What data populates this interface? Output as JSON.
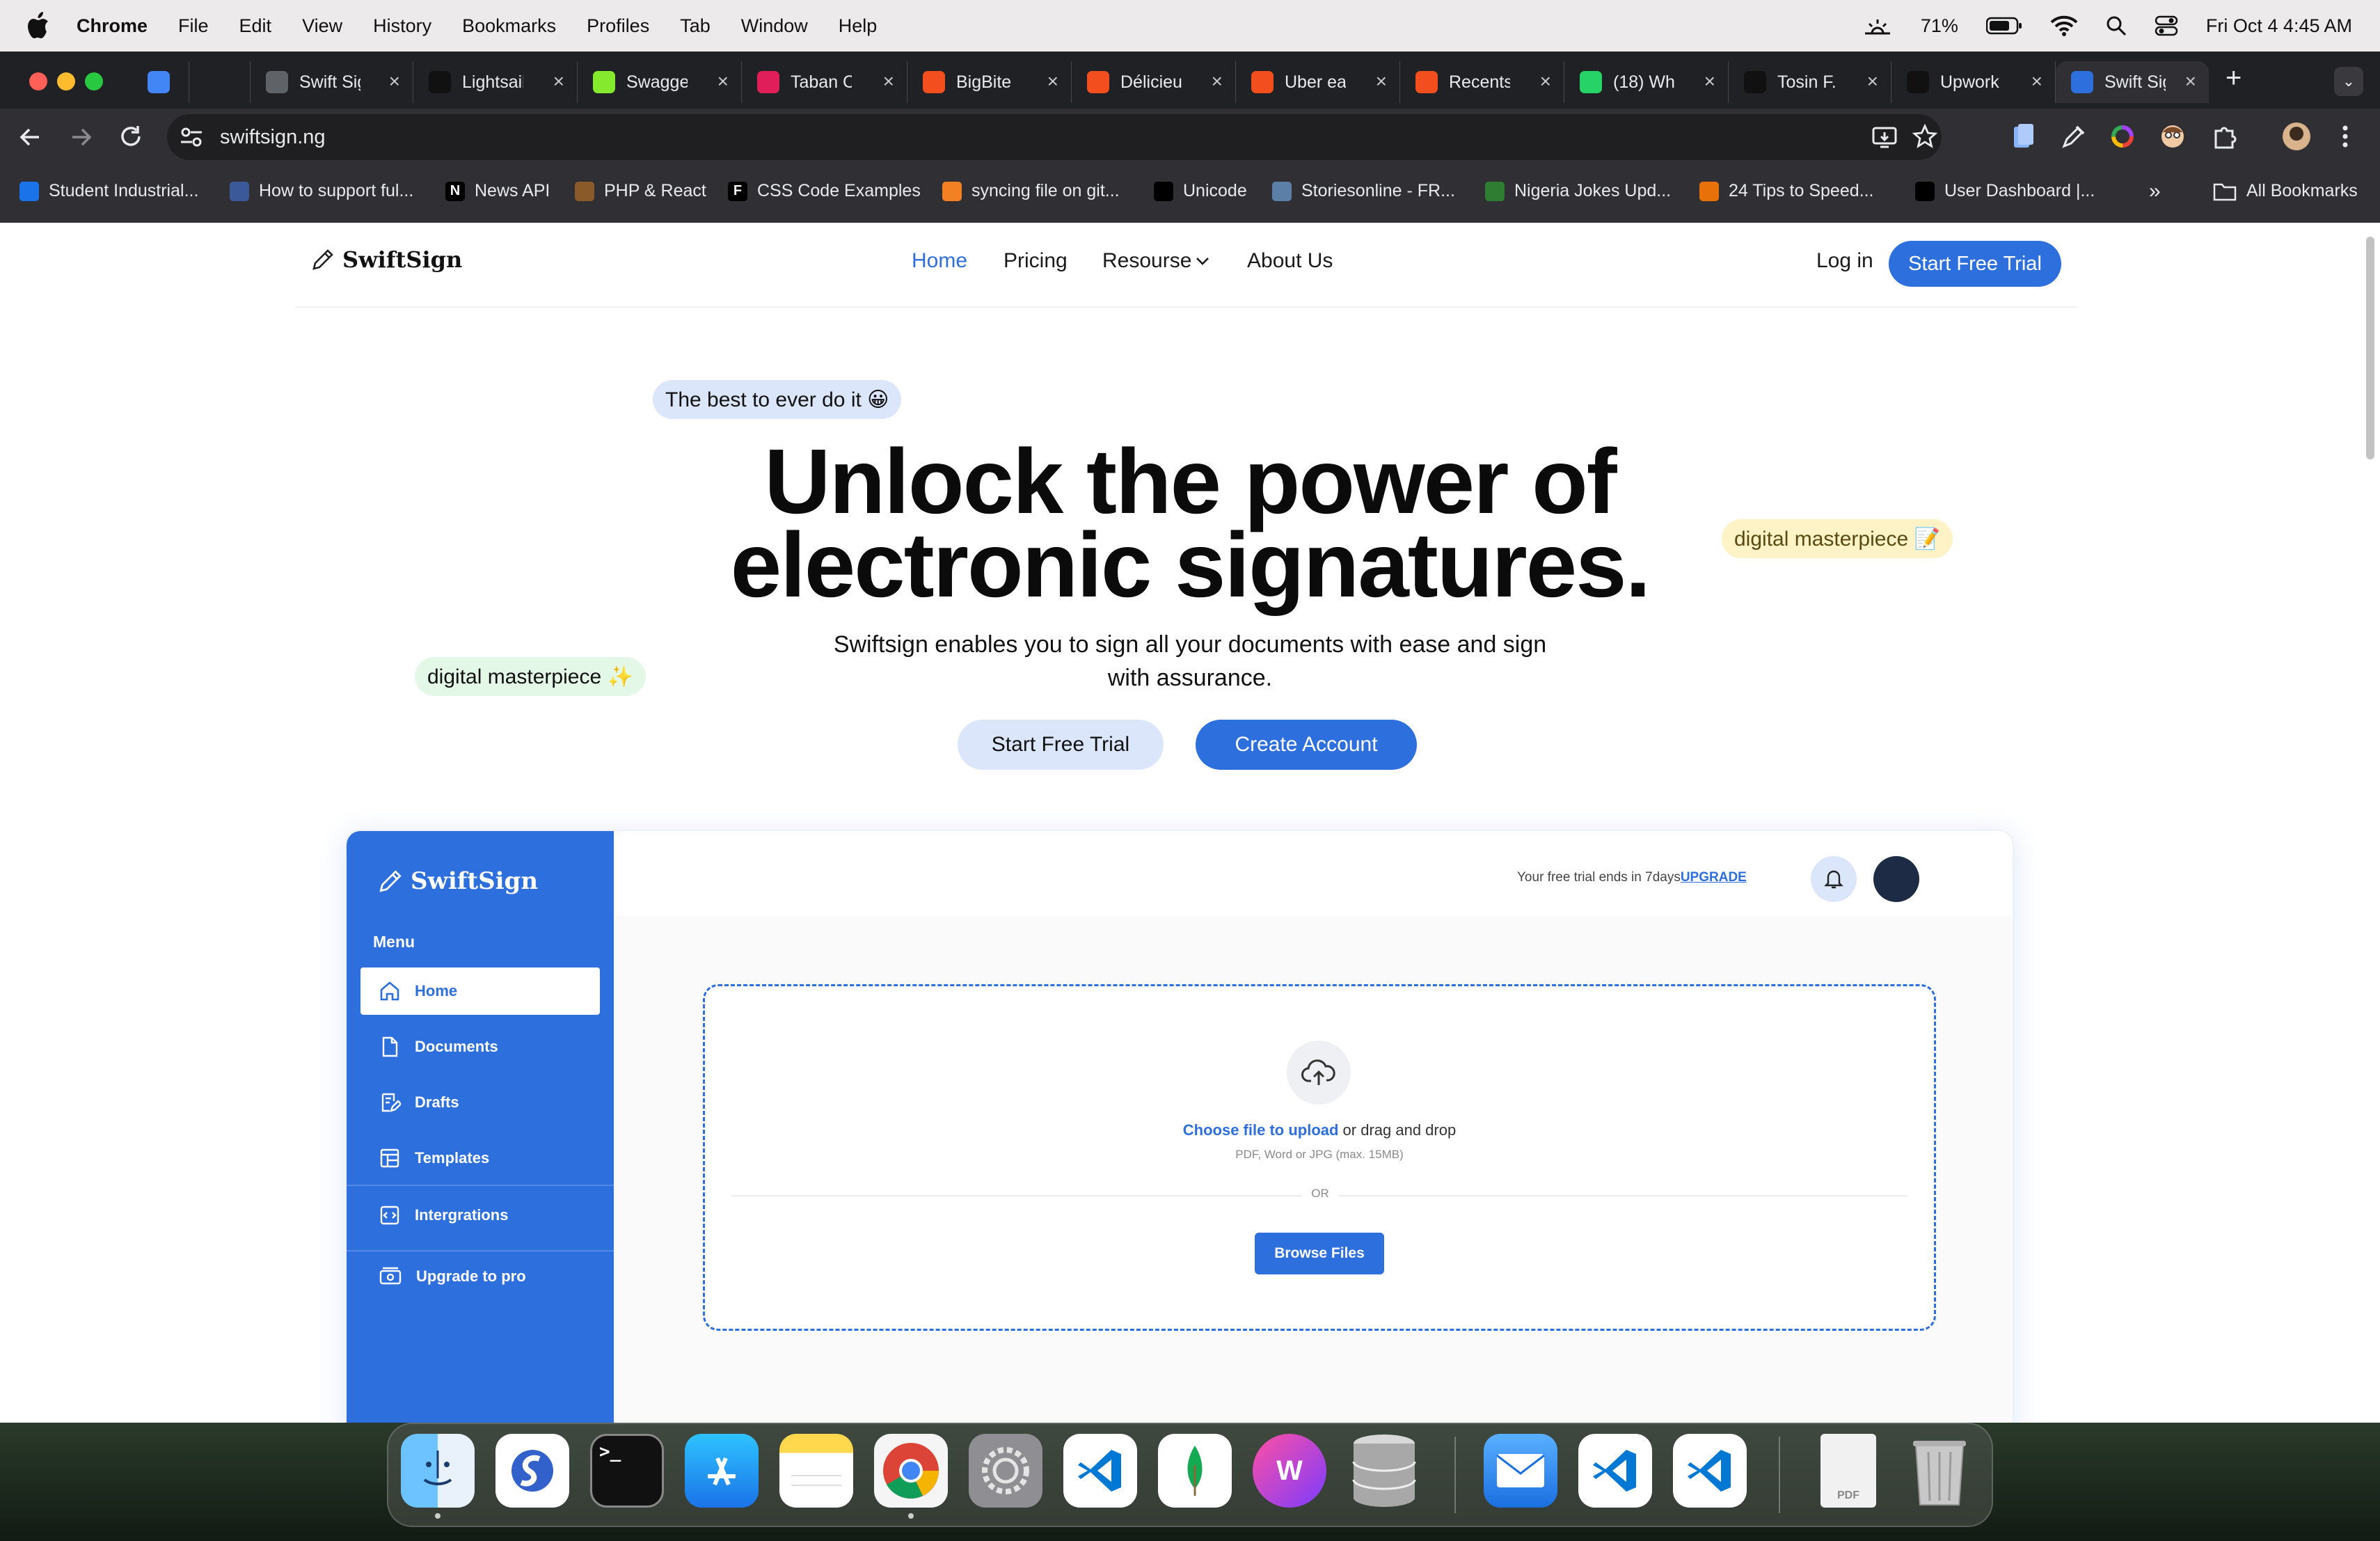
{
  "menubar": {
    "app": "Chrome",
    "items": [
      "File",
      "Edit",
      "View",
      "History",
      "Bookmarks",
      "Profiles",
      "Tab",
      "Window",
      "Help"
    ],
    "battery": "71%",
    "clock": "Fri Oct 4  4:45 AM"
  },
  "tabs": [
    {
      "title": "",
      "favicon": "calendar-icon",
      "color": "#4285f4"
    },
    {
      "title": "",
      "favicon": "hub-icon",
      "color": "#202124"
    },
    {
      "title": "Swift Sig",
      "favicon": "globe-icon",
      "color": "#5f6368"
    },
    {
      "title": "Lightsail",
      "favicon": "lightsail-icon",
      "color": "#111111"
    },
    {
      "title": "Swagger",
      "favicon": "swagger-icon",
      "color": "#85ea2d"
    },
    {
      "title": "Taban C",
      "favicon": "slack-icon",
      "color": "#e01e5a"
    },
    {
      "title": "BigBite",
      "favicon": "figma-icon",
      "color": "#f24e1e"
    },
    {
      "title": "Délicieu",
      "favicon": "figma-icon",
      "color": "#f24e1e"
    },
    {
      "title": "Uber ea",
      "favicon": "figma-icon",
      "color": "#f24e1e"
    },
    {
      "title": "Recents",
      "favicon": "figma-icon",
      "color": "#f24e1e"
    },
    {
      "title": "(18) Wh",
      "favicon": "whatsapp-icon",
      "color": "#25d366"
    },
    {
      "title": "Tosin F.",
      "favicon": "upwork-icon",
      "color": "#111111"
    },
    {
      "title": "Upwork",
      "favicon": "upwork-icon",
      "color": "#111111"
    },
    {
      "title": "Swift Sig",
      "favicon": "pen-icon",
      "color": "#2e6fde"
    }
  ],
  "address": {
    "url": "swiftsign.ng"
  },
  "bookmarks": [
    {
      "label": "Student Industrial...",
      "color": "#1a73e8"
    },
    {
      "label": "How to support ful...",
      "color": "#3b5998"
    },
    {
      "label": "News API",
      "glyph": "N",
      "color": "#000000"
    },
    {
      "label": "PHP & React",
      "color": "#8a5a2b"
    },
    {
      "label": "CSS Code Examples",
      "glyph": "F",
      "color": "#000000"
    },
    {
      "label": "syncing file on git...",
      "color": "#f48024"
    },
    {
      "label": "Unicode",
      "color": "#000000"
    },
    {
      "label": "Storiesonline - FR...",
      "color": "#5b7fa6"
    },
    {
      "label": "Nigeria Jokes Upd...",
      "color": "#2e7d32"
    },
    {
      "label": "24 Tips to Speed...",
      "color": "#e8710a"
    },
    {
      "label": "User Dashboard |...",
      "color": "#000000"
    }
  ],
  "all_bookmarks": "All Bookmarks",
  "site": {
    "brand": "SwiftSign",
    "nav": [
      "Home",
      "Pricing",
      "Resourse",
      "About Us"
    ],
    "login": "Log in",
    "cta": "Start Free Trial"
  },
  "hero": {
    "chip_top": "The best to ever do it 😀",
    "chip_right": "digital masterpiece 📝",
    "chip_left": "digital masterpiece ✨",
    "title_line1": "Unlock the power of",
    "title_line2": "electronic signatures.",
    "subtitle": "Swiftsign enables you to sign all your documents with ease and sign with assurance.",
    "btn_trial": "Start Free Trial",
    "btn_account": "Create Account"
  },
  "dashboard": {
    "brand": "SwiftSign",
    "menu_label": "Menu",
    "items": [
      "Home",
      "Documents",
      "Drafts",
      "Templates",
      "Intergrations",
      "Upgrade to pro"
    ],
    "trial_text": "Your free trial ends in 7days",
    "upgrade": "UPGRADE",
    "upload_link": "Choose file to upload",
    "upload_rest": " or drag and drop",
    "upload_hint": "PDF, Word or JPG (max. 15MB)",
    "or": "OR",
    "browse": "Browse Files"
  },
  "dock": [
    "Finder",
    "Simplenote",
    "Terminal",
    "App Store",
    "Notes",
    "Chrome",
    "System Settings",
    "VS Code",
    "MongoDB Compass",
    "WPS Office",
    "Database",
    "Mail",
    "VS Code",
    "VS Code",
    "PDF",
    "Trash"
  ],
  "colors": {
    "brand_blue": "#2e6fde",
    "chip_blue": "#dbe6fb",
    "chip_yellow": "#fdf3c6",
    "chip_green": "#e4f8e7"
  }
}
